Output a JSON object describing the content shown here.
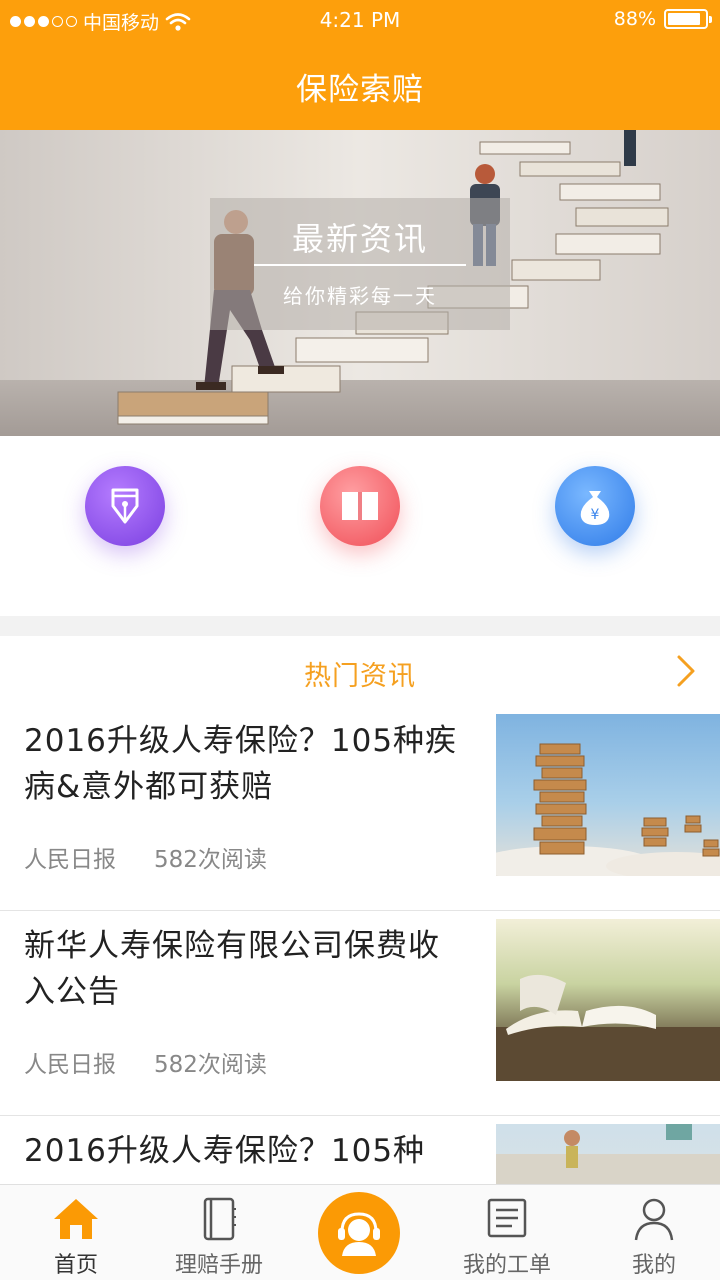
{
  "status_bar": {
    "carrier": "中国移动",
    "time": "4:21 PM",
    "battery": "88%",
    "battery_level": 0.88
  },
  "header": {
    "title": "保险索赔"
  },
  "banner": {
    "title": "最新资讯",
    "subtitle": "给你精彩每一天"
  },
  "categories": [
    {
      "icon": "pen-nib-icon",
      "color": "#8c52f0"
    },
    {
      "icon": "book-icon",
      "color": "#f0545c"
    },
    {
      "icon": "money-bag-icon",
      "color": "#3a85ec"
    }
  ],
  "hot_news": {
    "title": "热门资讯"
  },
  "news": [
    {
      "title": "2016升级人寿保险？105种疾病&意外都可获赔",
      "source": "人民日报",
      "reads": "582次阅读"
    },
    {
      "title": "新华人寿保险有限公司保费收入公告",
      "source": "人民日报",
      "reads": "582次阅读"
    },
    {
      "title": "2016升级人寿保险？105种"
    }
  ],
  "tabs": [
    {
      "label": "首页",
      "icon": "home-icon",
      "active": true
    },
    {
      "label": "理赔手册",
      "icon": "notebook-icon"
    },
    {
      "label": "",
      "icon": "customer-service-icon"
    },
    {
      "label": "我的工单",
      "icon": "document-icon"
    },
    {
      "label": "我的",
      "icon": "user-icon"
    }
  ],
  "colors": {
    "brand": "#fd9f0c",
    "accent_text": "#f5a020"
  }
}
